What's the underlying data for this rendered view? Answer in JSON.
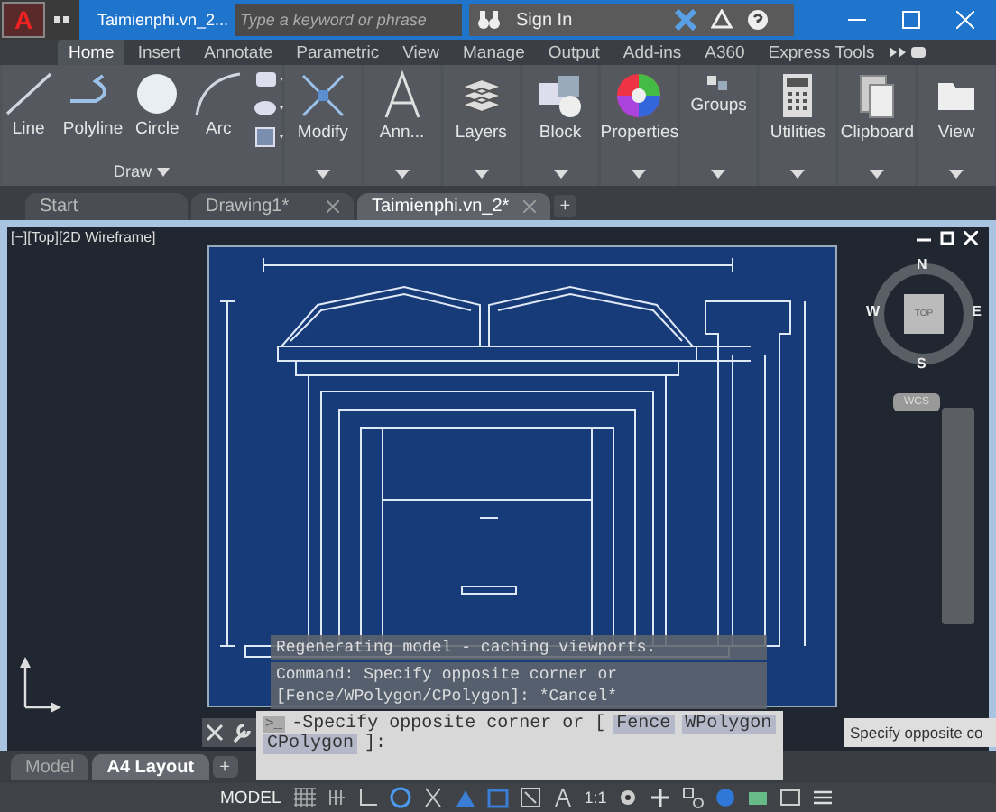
{
  "title_bar": {
    "logo": "A",
    "document": "Taimienphi.vn_2...",
    "search": {
      "placeholder": "Type a keyword or phrase"
    },
    "sign_in": "Sign In"
  },
  "ribbon_tabs": [
    {
      "label": "Home",
      "selected": true
    },
    {
      "label": "Insert",
      "selected": false
    },
    {
      "label": "Annotate",
      "selected": false
    },
    {
      "label": "Parametric",
      "selected": false
    },
    {
      "label": "View",
      "selected": false
    },
    {
      "label": "Manage",
      "selected": false
    },
    {
      "label": "Output",
      "selected": false
    },
    {
      "label": "Add-ins",
      "selected": false
    },
    {
      "label": "A360",
      "selected": false
    },
    {
      "label": "Express Tools",
      "selected": false
    }
  ],
  "draw_panel": {
    "title": "Draw",
    "tools": [
      {
        "label": "Line",
        "kind": "line"
      },
      {
        "label": "Polyline",
        "kind": "polyline"
      },
      {
        "label": "Circle",
        "kind": "circle"
      },
      {
        "label": "Arc",
        "kind": "arc"
      }
    ]
  },
  "panels": [
    {
      "label": "Modify",
      "kind": "modify"
    },
    {
      "label": "Ann...",
      "kind": "annotation"
    },
    {
      "label": "Layers",
      "kind": "layers"
    },
    {
      "label": "Block",
      "kind": "block"
    },
    {
      "label": "Properties",
      "kind": "properties"
    },
    {
      "label": "Groups",
      "kind": "groups"
    },
    {
      "label": "Utilities",
      "kind": "utilities"
    },
    {
      "label": "Clipboard",
      "kind": "clipboard"
    },
    {
      "label": "View",
      "kind": "view"
    }
  ],
  "doc_tabs": [
    {
      "label": "Start",
      "selected": false,
      "closable": false
    },
    {
      "label": "Drawing1*",
      "selected": false,
      "closable": true
    },
    {
      "label": "Taimienphi.vn_2*",
      "selected": true,
      "closable": true
    }
  ],
  "new_tab": "+",
  "viewport": {
    "label": "[−][Top][2D Wireframe]",
    "viewcube": {
      "north": "N",
      "west": "W",
      "east": "E",
      "south": "S",
      "face": "TOP",
      "ucs": "WCS"
    }
  },
  "command_history": [
    "Regenerating model - caching viewports.",
    "Command: Specify opposite corner or [Fence/WPolygon/CPolygon]: *Cancel*"
  ],
  "command_prompt": {
    "marker": ">_",
    "text": "-Specify opposite corner or [",
    "options": [
      "Fence",
      "WPolygon",
      "CPolygon"
    ],
    "end": "]:"
  },
  "tooltip": "Specify opposite co",
  "layout_tabs": [
    {
      "label": "Model",
      "selected": false
    },
    {
      "label": "A4 Layout",
      "selected": true
    }
  ],
  "new_layout": "+",
  "status_bar": {
    "space": "MODEL",
    "scale": "1:1"
  }
}
